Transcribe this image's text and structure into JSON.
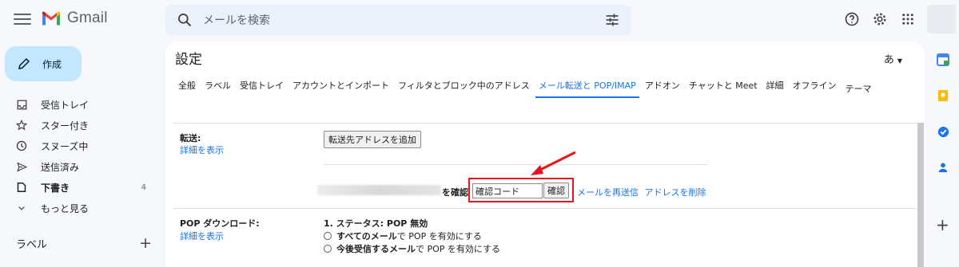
{
  "brand": {
    "name": "Gmail"
  },
  "search": {
    "placeholder": "メールを検索"
  },
  "compose": {
    "label": "作成"
  },
  "nav": {
    "items": [
      {
        "label": "受信トレイ",
        "icon": "inbox-icon"
      },
      {
        "label": "スター付き",
        "icon": "star-icon"
      },
      {
        "label": "スヌーズ中",
        "icon": "clock-icon"
      },
      {
        "label": "送信済み",
        "icon": "send-icon"
      },
      {
        "label": "下書き",
        "icon": "draft-icon",
        "count": "4"
      },
      {
        "label": "もっと見る",
        "icon": "chevron-down-icon"
      }
    ],
    "labels_heading": "ラベル",
    "labels_add": "+"
  },
  "settings": {
    "title": "設定",
    "input_tool": "あ",
    "tabs": [
      "全般",
      "ラベル",
      "受信トレイ",
      "アカウントとインポート",
      "フィルタとブロック中のアドレス",
      "メール転送と POP/IMAP",
      "アドオン",
      "チャットと Meet",
      "詳細",
      "オフライン",
      "テーマ"
    ],
    "active_tab": "メール転送と POP/IMAP",
    "forwarding": {
      "label": "転送:",
      "details_link": "詳細を表示",
      "add_button": "転送先アドレスを追加",
      "confirm_prefix": "を確認",
      "code_placeholder": "確認コード",
      "confirm_button": "確認",
      "resend_link": "メールを再送信",
      "delete_link": "アドレスを削除"
    },
    "pop": {
      "label": "POP ダウンロード:",
      "details_link": "詳細を表示",
      "status": "1. ステータス: POP 無効",
      "options": [
        {
          "bold": "すべてのメール",
          "rest": "で POP を有効にする"
        },
        {
          "bold": "今後受信するメール",
          "rest": "で POP を有効にする"
        }
      ]
    }
  },
  "colors": {
    "accent": "#1a73e8",
    "highlight": "#e5141d",
    "compose_bg": "#c2e7ff"
  }
}
